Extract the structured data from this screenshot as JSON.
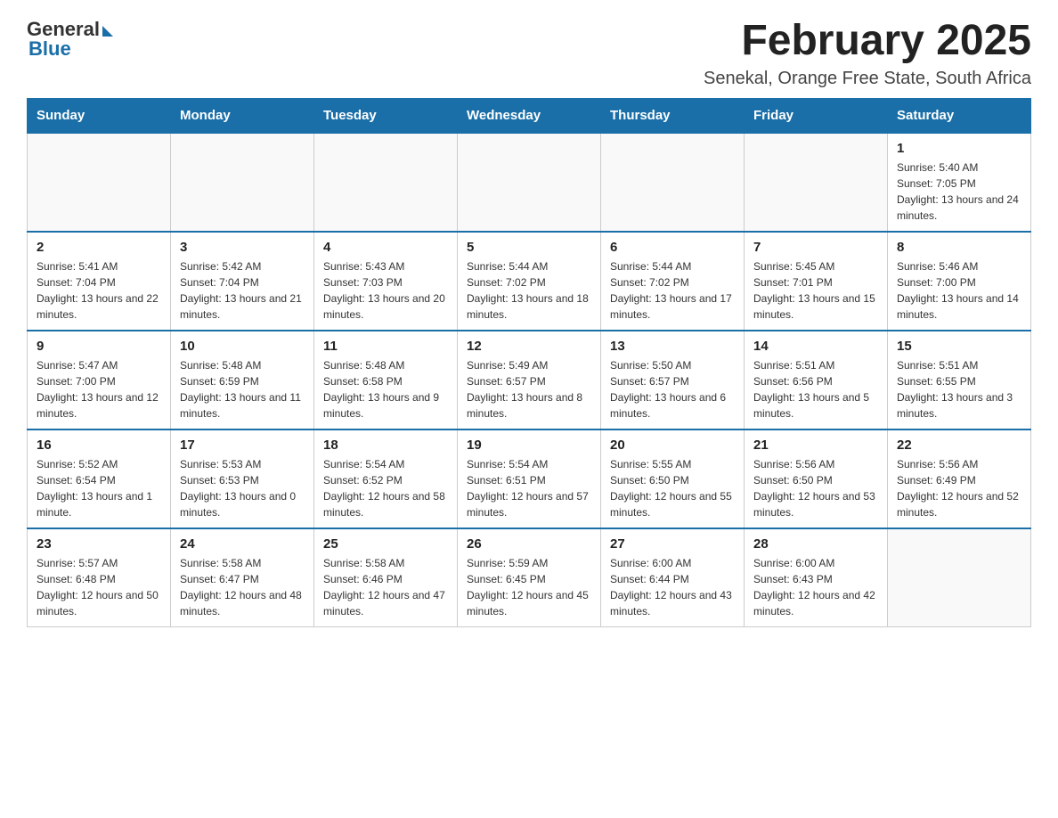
{
  "header": {
    "logo_general": "General",
    "logo_blue": "Blue",
    "month_title": "February 2025",
    "location": "Senekal, Orange Free State, South Africa"
  },
  "days_of_week": [
    "Sunday",
    "Monday",
    "Tuesday",
    "Wednesday",
    "Thursday",
    "Friday",
    "Saturday"
  ],
  "weeks": [
    [
      {
        "day": "",
        "info": ""
      },
      {
        "day": "",
        "info": ""
      },
      {
        "day": "",
        "info": ""
      },
      {
        "day": "",
        "info": ""
      },
      {
        "day": "",
        "info": ""
      },
      {
        "day": "",
        "info": ""
      },
      {
        "day": "1",
        "info": "Sunrise: 5:40 AM\nSunset: 7:05 PM\nDaylight: 13 hours and 24 minutes."
      }
    ],
    [
      {
        "day": "2",
        "info": "Sunrise: 5:41 AM\nSunset: 7:04 PM\nDaylight: 13 hours and 22 minutes."
      },
      {
        "day": "3",
        "info": "Sunrise: 5:42 AM\nSunset: 7:04 PM\nDaylight: 13 hours and 21 minutes."
      },
      {
        "day": "4",
        "info": "Sunrise: 5:43 AM\nSunset: 7:03 PM\nDaylight: 13 hours and 20 minutes."
      },
      {
        "day": "5",
        "info": "Sunrise: 5:44 AM\nSunset: 7:02 PM\nDaylight: 13 hours and 18 minutes."
      },
      {
        "day": "6",
        "info": "Sunrise: 5:44 AM\nSunset: 7:02 PM\nDaylight: 13 hours and 17 minutes."
      },
      {
        "day": "7",
        "info": "Sunrise: 5:45 AM\nSunset: 7:01 PM\nDaylight: 13 hours and 15 minutes."
      },
      {
        "day": "8",
        "info": "Sunrise: 5:46 AM\nSunset: 7:00 PM\nDaylight: 13 hours and 14 minutes."
      }
    ],
    [
      {
        "day": "9",
        "info": "Sunrise: 5:47 AM\nSunset: 7:00 PM\nDaylight: 13 hours and 12 minutes."
      },
      {
        "day": "10",
        "info": "Sunrise: 5:48 AM\nSunset: 6:59 PM\nDaylight: 13 hours and 11 minutes."
      },
      {
        "day": "11",
        "info": "Sunrise: 5:48 AM\nSunset: 6:58 PM\nDaylight: 13 hours and 9 minutes."
      },
      {
        "day": "12",
        "info": "Sunrise: 5:49 AM\nSunset: 6:57 PM\nDaylight: 13 hours and 8 minutes."
      },
      {
        "day": "13",
        "info": "Sunrise: 5:50 AM\nSunset: 6:57 PM\nDaylight: 13 hours and 6 minutes."
      },
      {
        "day": "14",
        "info": "Sunrise: 5:51 AM\nSunset: 6:56 PM\nDaylight: 13 hours and 5 minutes."
      },
      {
        "day": "15",
        "info": "Sunrise: 5:51 AM\nSunset: 6:55 PM\nDaylight: 13 hours and 3 minutes."
      }
    ],
    [
      {
        "day": "16",
        "info": "Sunrise: 5:52 AM\nSunset: 6:54 PM\nDaylight: 13 hours and 1 minute."
      },
      {
        "day": "17",
        "info": "Sunrise: 5:53 AM\nSunset: 6:53 PM\nDaylight: 13 hours and 0 minutes."
      },
      {
        "day": "18",
        "info": "Sunrise: 5:54 AM\nSunset: 6:52 PM\nDaylight: 12 hours and 58 minutes."
      },
      {
        "day": "19",
        "info": "Sunrise: 5:54 AM\nSunset: 6:51 PM\nDaylight: 12 hours and 57 minutes."
      },
      {
        "day": "20",
        "info": "Sunrise: 5:55 AM\nSunset: 6:50 PM\nDaylight: 12 hours and 55 minutes."
      },
      {
        "day": "21",
        "info": "Sunrise: 5:56 AM\nSunset: 6:50 PM\nDaylight: 12 hours and 53 minutes."
      },
      {
        "day": "22",
        "info": "Sunrise: 5:56 AM\nSunset: 6:49 PM\nDaylight: 12 hours and 52 minutes."
      }
    ],
    [
      {
        "day": "23",
        "info": "Sunrise: 5:57 AM\nSunset: 6:48 PM\nDaylight: 12 hours and 50 minutes."
      },
      {
        "day": "24",
        "info": "Sunrise: 5:58 AM\nSunset: 6:47 PM\nDaylight: 12 hours and 48 minutes."
      },
      {
        "day": "25",
        "info": "Sunrise: 5:58 AM\nSunset: 6:46 PM\nDaylight: 12 hours and 47 minutes."
      },
      {
        "day": "26",
        "info": "Sunrise: 5:59 AM\nSunset: 6:45 PM\nDaylight: 12 hours and 45 minutes."
      },
      {
        "day": "27",
        "info": "Sunrise: 6:00 AM\nSunset: 6:44 PM\nDaylight: 12 hours and 43 minutes."
      },
      {
        "day": "28",
        "info": "Sunrise: 6:00 AM\nSunset: 6:43 PM\nDaylight: 12 hours and 42 minutes."
      },
      {
        "day": "",
        "info": ""
      }
    ]
  ]
}
